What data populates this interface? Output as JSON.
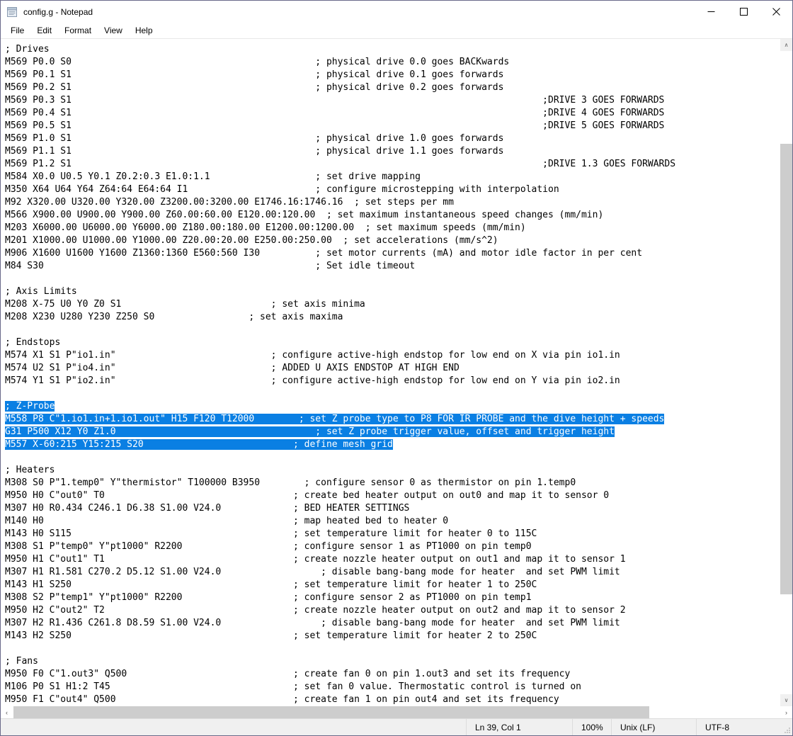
{
  "window": {
    "title": "config.g - Notepad",
    "icon": "notepad-icon",
    "minimize_label": "—",
    "maximize_label": "□",
    "close_label": "✕"
  },
  "menubar": {
    "items": [
      {
        "label": "File"
      },
      {
        "label": "Edit"
      },
      {
        "label": "Format"
      },
      {
        "label": "View"
      },
      {
        "label": "Help"
      }
    ]
  },
  "statusbar": {
    "position": "Ln 39, Col 1",
    "zoom": "100%",
    "line_ending": "Unix (LF)",
    "encoding": "UTF-8"
  },
  "scrollbars": {
    "vertical_up_arrow": "∧",
    "vertical_down_arrow": "∨",
    "horizontal_left_arrow": "‹",
    "horizontal_right_arrow": "›"
  },
  "colors": {
    "selection_bg": "#0a7fe3",
    "selection_fg": "#ffffff",
    "scrollbar_thumb": "#cdcdcd",
    "statusbar_bg": "#f0f0f0"
  },
  "document": {
    "filename": "config.g",
    "lines": [
      {
        "text": "; Drives",
        "selected": false
      },
      {
        "text": "M569 P0.0 S0                                            ; physical drive 0.0 goes BACKwards",
        "selected": false
      },
      {
        "text": "M569 P0.1 S1                                            ; physical drive 0.1 goes forwards",
        "selected": false
      },
      {
        "text": "M569 P0.2 S1                                            ; physical drive 0.2 goes forwards",
        "selected": false
      },
      {
        "text": "M569 P0.3 S1                                                                                     ;DRIVE 3 GOES FORWARDS",
        "selected": false
      },
      {
        "text": "M569 P0.4 S1                                                                                     ;DRIVE 4 GOES FORWARDS",
        "selected": false
      },
      {
        "text": "M569 P0.5 S1                                                                                     ;DRIVE 5 GOES FORWARDS",
        "selected": false
      },
      {
        "text": "M569 P1.0 S1                                            ; physical drive 1.0 goes forwards",
        "selected": false
      },
      {
        "text": "M569 P1.1 S1                                            ; physical drive 1.1 goes forwards",
        "selected": false
      },
      {
        "text": "M569 P1.2 S1                                                                                     ;DRIVE 1.3 GOES FORWARDS",
        "selected": false
      },
      {
        "text": "M584 X0.0 U0.5 Y0.1 Z0.2:0.3 E1.0:1.1                   ; set drive mapping",
        "selected": false
      },
      {
        "text": "M350 X64 U64 Y64 Z64:64 E64:64 I1                       ; configure microstepping with interpolation",
        "selected": false
      },
      {
        "text": "M92 X320.00 U320.00 Y320.00 Z3200.00:3200.00 E1746.16:1746.16  ; set steps per mm",
        "selected": false
      },
      {
        "text": "M566 X900.00 U900.00 Y900.00 Z60.00:60.00 E120.00:120.00  ; set maximum instantaneous speed changes (mm/min)",
        "selected": false
      },
      {
        "text": "M203 X6000.00 U6000.00 Y6000.00 Z180.00:180.00 E1200.00:1200.00  ; set maximum speeds (mm/min)",
        "selected": false
      },
      {
        "text": "M201 X1000.00 U1000.00 Y1000.00 Z20.00:20.00 E250.00:250.00  ; set accelerations (mm/s^2)",
        "selected": false
      },
      {
        "text": "M906 X1600 U1600 Y1600 Z1360:1360 E560:560 I30          ; set motor currents (mA) and motor idle factor in per cent",
        "selected": false
      },
      {
        "text": "M84 S30                                                 ; Set idle timeout",
        "selected": false
      },
      {
        "text": "",
        "selected": false
      },
      {
        "text": "; Axis Limits",
        "selected": false
      },
      {
        "text": "M208 X-75 U0 Y0 Z0 S1                           ; set axis minima",
        "selected": false
      },
      {
        "text": "M208 X230 U280 Y230 Z250 S0                 ; set axis maxima",
        "selected": false
      },
      {
        "text": "",
        "selected": false
      },
      {
        "text": "; Endstops",
        "selected": false
      },
      {
        "text": "M574 X1 S1 P\"io1.in\"                            ; configure active-high endstop for low end on X via pin io1.in",
        "selected": false
      },
      {
        "text": "M574 U2 S1 P\"io4.in\"                            ; ADDED U AXIS ENDSTOP AT HIGH END",
        "selected": false
      },
      {
        "text": "M574 Y1 S1 P\"io2.in\"                            ; configure active-high endstop for low end on Y via pin io2.in",
        "selected": false
      },
      {
        "text": "",
        "selected": false
      },
      {
        "text": "; Z-Probe",
        "selected": true
      },
      {
        "text": "M558 P8 C\"1.io1.in+1.io1.out\" H15 F120 T12000        ; set Z probe type to P8 FOR IR PROBE and the dive height + speeds",
        "selected": true
      },
      {
        "text": "G31 P500 X12 Y0 Z1.0                                    ; set Z probe trigger value, offset and trigger height",
        "selected": true
      },
      {
        "text": "M557 X-60:215 Y15:215 S20                           ; define mesh grid",
        "selected": true
      },
      {
        "text": "",
        "selected": false
      },
      {
        "text": "; Heaters",
        "selected": false
      },
      {
        "text": "M308 S0 P\"1.temp0\" Y\"thermistor\" T100000 B3950        ; configure sensor 0 as thermistor on pin 1.temp0",
        "selected": false
      },
      {
        "text": "M950 H0 C\"out0\" T0                                  ; create bed heater output on out0 and map it to sensor 0",
        "selected": false
      },
      {
        "text": "M307 H0 R0.434 C246.1 D6.38 S1.00 V24.0             ; BED HEATER SETTINGS",
        "selected": false
      },
      {
        "text": "M140 H0                                             ; map heated bed to heater 0",
        "selected": false
      },
      {
        "text": "M143 H0 S115                                        ; set temperature limit for heater 0 to 115C",
        "selected": false
      },
      {
        "text": "M308 S1 P\"temp0\" Y\"pt1000\" R2200                    ; configure sensor 1 as PT1000 on pin temp0",
        "selected": false
      },
      {
        "text": "M950 H1 C\"out1\" T1                                  ; create nozzle heater output on out1 and map it to sensor 1",
        "selected": false
      },
      {
        "text": "M307 H1 R1.581 C270.2 D5.12 S1.00 V24.0                  ; disable bang-bang mode for heater  and set PWM limit",
        "selected": false
      },
      {
        "text": "M143 H1 S250                                        ; set temperature limit for heater 1 to 250C",
        "selected": false
      },
      {
        "text": "M308 S2 P\"temp1\" Y\"pt1000\" R2200                    ; configure sensor 2 as PT1000 on pin temp1",
        "selected": false
      },
      {
        "text": "M950 H2 C\"out2\" T2                                  ; create nozzle heater output on out2 and map it to sensor 2",
        "selected": false
      },
      {
        "text": "M307 H2 R1.436 C261.8 D8.59 S1.00 V24.0                  ; disable bang-bang mode for heater  and set PWM limit",
        "selected": false
      },
      {
        "text": "M143 H2 S250                                        ; set temperature limit for heater 2 to 250C",
        "selected": false
      },
      {
        "text": "",
        "selected": false
      },
      {
        "text": "; Fans",
        "selected": false
      },
      {
        "text": "M950 F0 C\"1.out3\" Q500                              ; create fan 0 on pin 1.out3 and set its frequency",
        "selected": false
      },
      {
        "text": "M106 P0 S1 H1:2 T45                                 ; set fan 0 value. Thermostatic control is turned on",
        "selected": false
      },
      {
        "text": "M950 F1 C\"out4\" Q500                                ; create fan 1 on pin out4 and set its frequency",
        "selected": false
      }
    ]
  }
}
